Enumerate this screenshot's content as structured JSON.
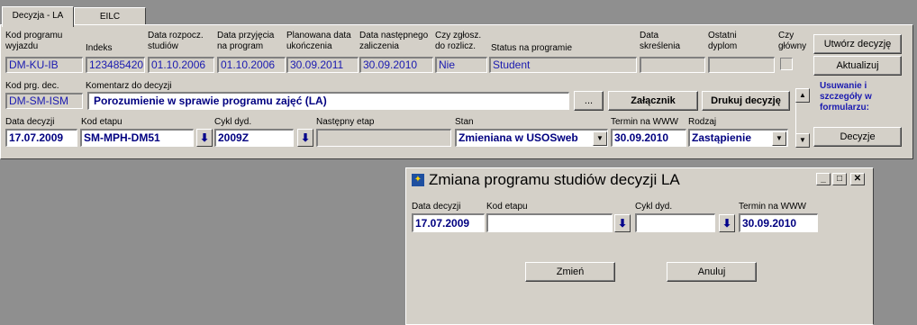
{
  "tabs": [
    {
      "label": "Decyzja - LA"
    },
    {
      "label": "EILC"
    }
  ],
  "row1": {
    "labels": {
      "kod_programu": "Kod programu wyjazdu",
      "indeks": "Indeks",
      "data_rozpocz": "Data rozpocz. studiów",
      "data_przyjecia": "Data przyjęcia na program",
      "planowana": "Planowana data ukończenia",
      "nastepnego": "Data następnego zaliczenia",
      "czy_zgloszono": "Czy zgłosz. do rozlicz.",
      "status": "Status na programie",
      "data_skreslenia": "Data skreślenia",
      "ostatni": "Ostatni dyplom",
      "czy_glowny": "Czy główny"
    },
    "values": {
      "kod_programu": "DM-KU-IB",
      "indeks": "123485420",
      "data_rozpocz": "01.10.2006",
      "data_przyjecia": "01.10.2006",
      "planowana": "30.09.2011",
      "nastepnego": "30.09.2010",
      "czy_zgloszono": "Nie",
      "status": "Student",
      "data_skreslenia": "",
      "ostatni": ""
    }
  },
  "row2": {
    "labels": {
      "kod_prg": "Kod prg. dec.",
      "komentarz": "Komentarz  do decyzji"
    },
    "values": {
      "kod_prg": "DM-SM-ISM",
      "komentarz": "Porozumienie w sprawie programu zajęć (LA)"
    },
    "ellipsis": "...",
    "zalacznik": "Załącznik",
    "drukuj": "Drukuj decyzję"
  },
  "row3": {
    "labels": {
      "data_decyzji": "Data decyzji",
      "kod_etapu": "Kod etapu",
      "cykl": "Cykl dyd.",
      "nastepny": "Następny etap",
      "stan": "Stan",
      "termin": "Termin na WWW",
      "rodzaj": "Rodzaj"
    },
    "values": {
      "data_decyzji": "17.07.2009",
      "kod_etapu": "SM-MPH-DM51",
      "cykl": "2009Z",
      "nastepny": "",
      "stan": "Zmieniana w USOSweb",
      "termin": "30.09.2010",
      "rodzaj": "Zastąpienie"
    }
  },
  "side": {
    "utworz": "Utwórz decyzję",
    "aktualizuj": "Aktualizuj",
    "info": "Usuwanie i szczegóły w formularzu:",
    "decyzje": "Decyzje"
  },
  "dialog": {
    "title": "Zmiana programu studiów decyzji LA",
    "labels": {
      "data_decyzji": "Data decyzji",
      "kod_etapu": "Kod etapu",
      "cykl": "Cykl dyd.",
      "termin": "Termin na WWW"
    },
    "values": {
      "data_decyzji": "17.07.2009",
      "kod_etapu": "",
      "cykl": "",
      "termin": "30.09.2010"
    },
    "zmien": "Zmień",
    "anuluj": "Anuluj"
  },
  "colors": {
    "accent_text": "#1a1ab0",
    "bold_text": "#000080",
    "face": "#d4d0c8"
  },
  "icons": {
    "lov": "download-arrow-icon",
    "dropdown": "chevron-down-icon"
  }
}
